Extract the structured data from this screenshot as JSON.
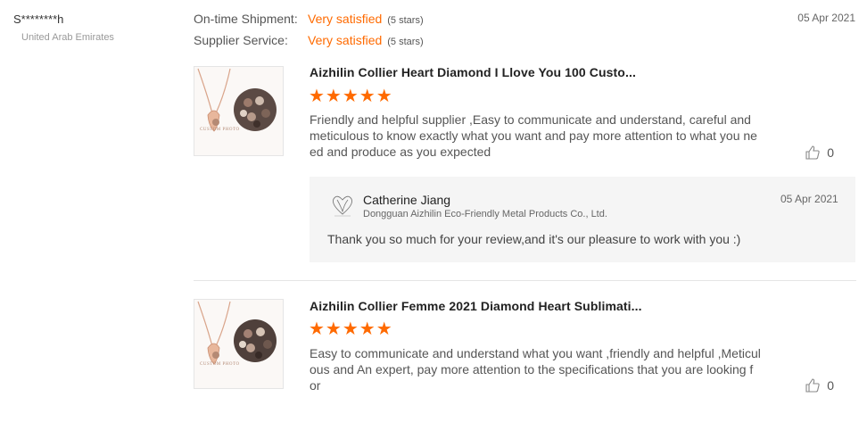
{
  "reviewer": {
    "name": "S********h",
    "country": "United Arab Emirates"
  },
  "ratings": [
    {
      "label": "On-time Shipment:",
      "value": "Very satisfied",
      "stars": "(5 stars)"
    },
    {
      "label": "Supplier Service:",
      "value": "Very satisfied",
      "stars": "(5 stars)"
    }
  ],
  "review_date": "05 Apr 2021",
  "products": [
    {
      "title": "Aizhilin Collier Heart Diamond I Llove You 100 Custo...",
      "stars": "★★★★★",
      "rating": 5,
      "text_lines": [
        "Friendly and helpful supplier ,Easy to communicate and understand, careful and",
        "meticulous to know exactly what you want and pay more attention to what you ne",
        "ed and produce as you expected"
      ],
      "likes": "0",
      "thumb_caption": "CUSTOM PHOTO"
    },
    {
      "title": "Aizhilin Collier Femme 2021 Diamond Heart Sublimati...",
      "stars": "★★★★★",
      "rating": 5,
      "text_lines": [
        "Easy to communicate and understand what you want ,friendly and helpful ,Meticul",
        "ous and An expert, pay more attention to the specifications that you are looking f",
        "or"
      ],
      "likes": "0",
      "thumb_caption": "CUSTOM PHOTO"
    }
  ],
  "reply": {
    "name": "Catherine Jiang",
    "company": "Dongguan Aizhilin Eco-Friendly Metal Products Co., Ltd.",
    "date": "05 Apr 2021",
    "text": "Thank you so much for  your review,and it's our pleasure to work with you :)"
  },
  "icons": {
    "like": "thumbs-up-icon",
    "logo": "heart-logo-icon"
  },
  "colors": {
    "accent": "#ff6a00",
    "reply_bg": "#f5f5f5"
  }
}
